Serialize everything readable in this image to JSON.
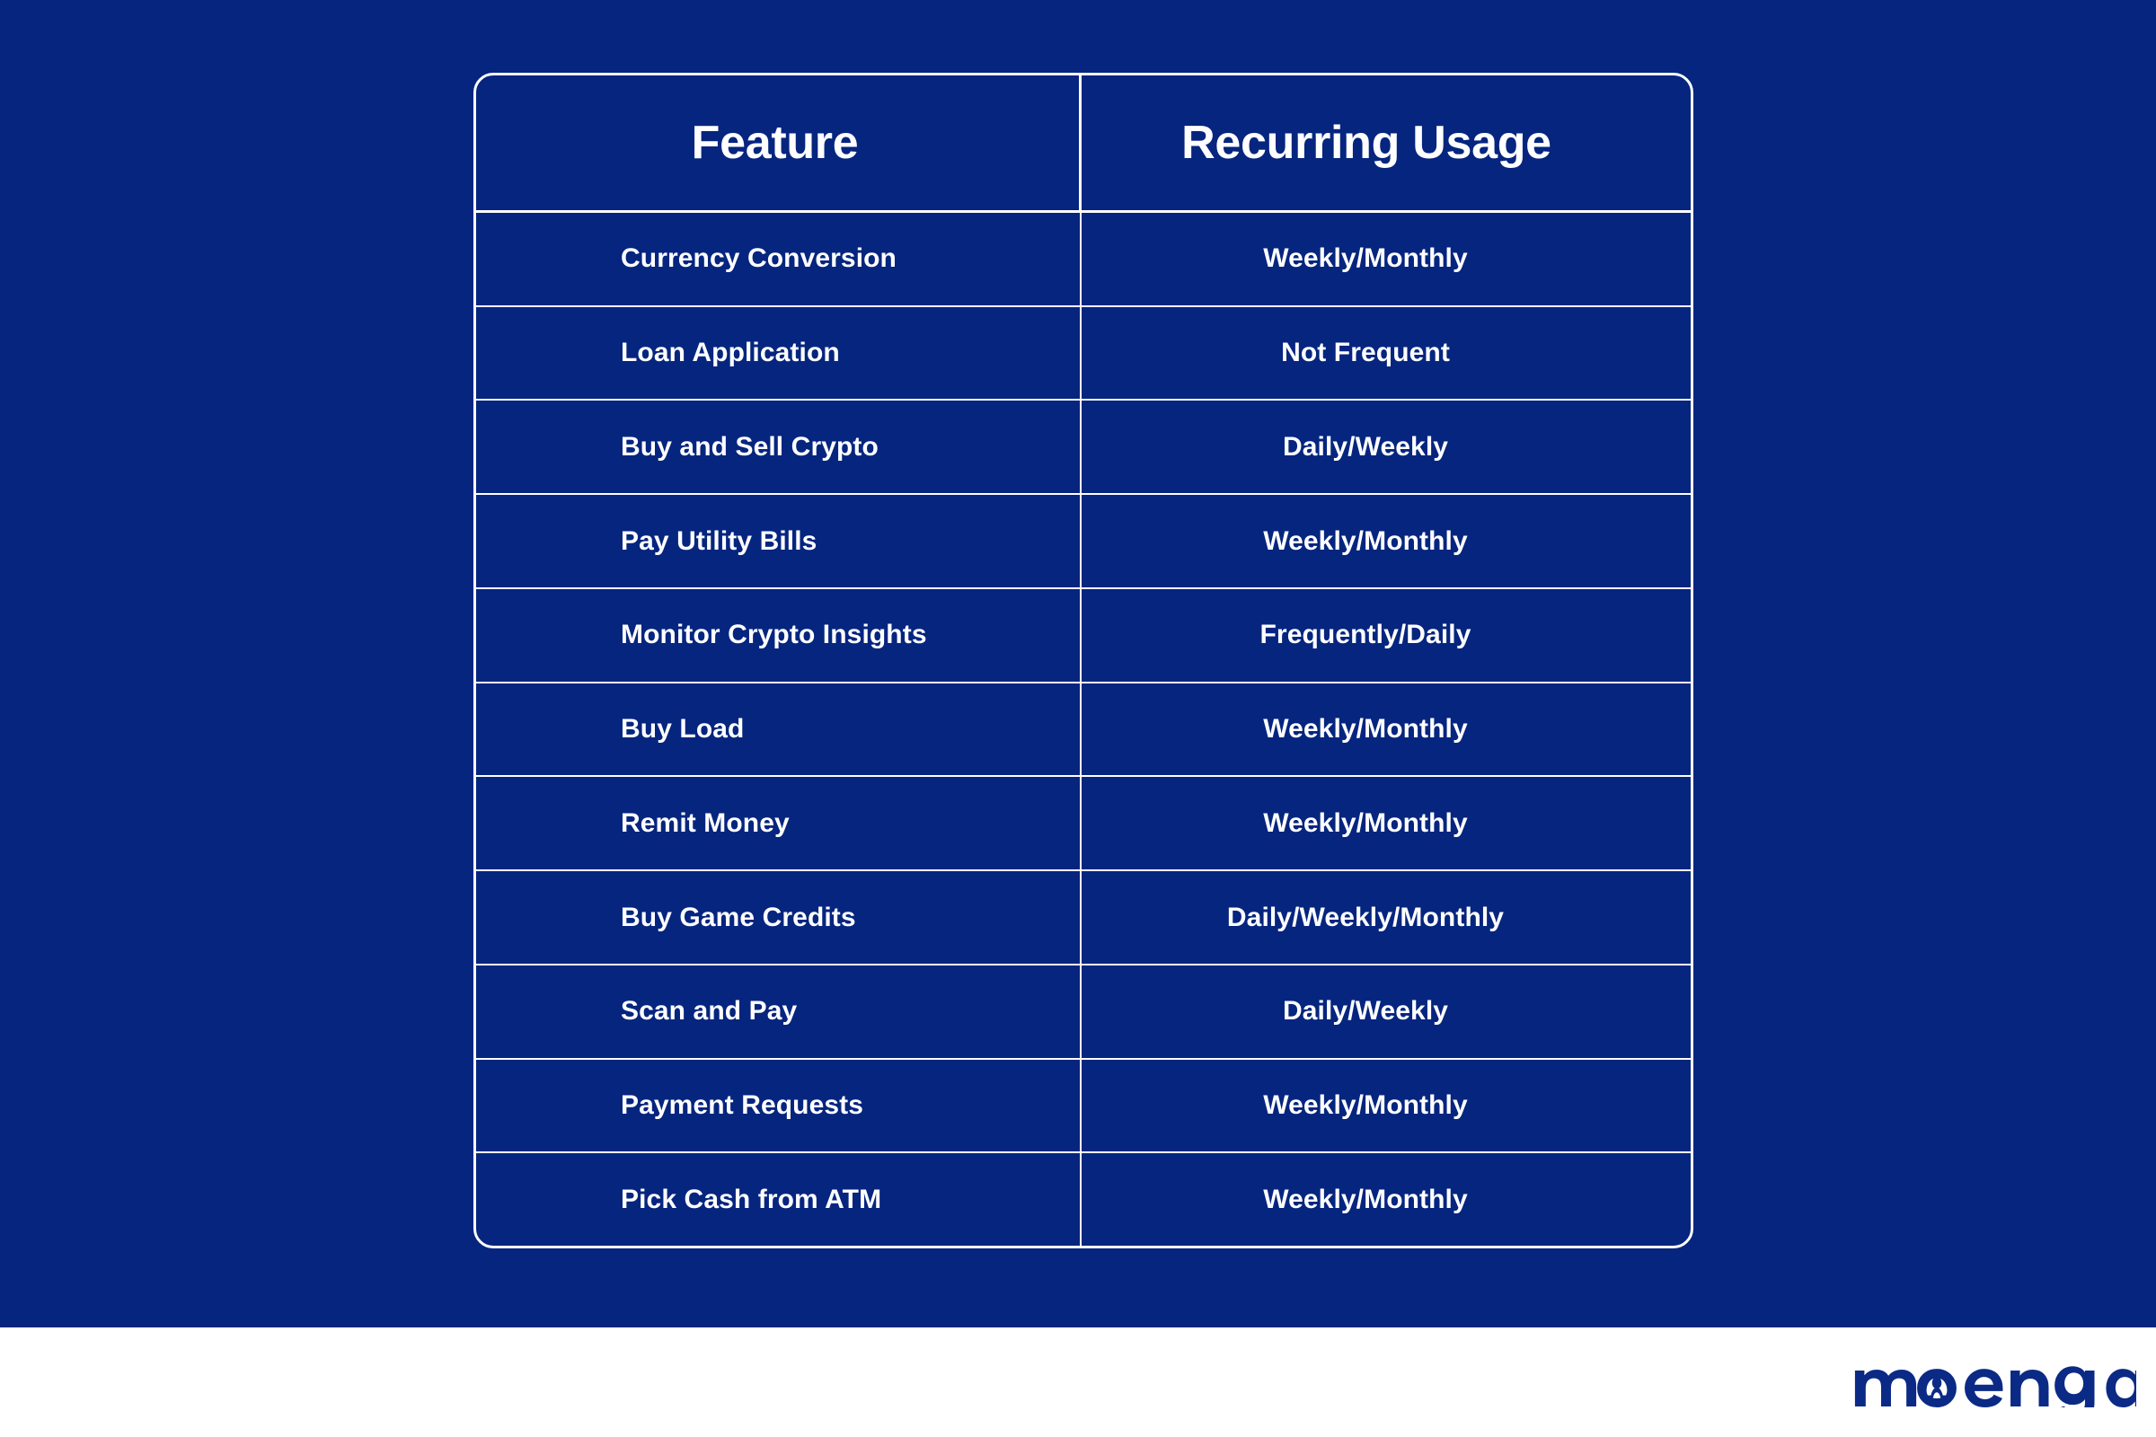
{
  "colors": {
    "background_blue": "#05257f",
    "footer_white": "#ffffff",
    "text_white": "#ffffff",
    "border_white": "#ffffff",
    "logo_blue": "#0b2a86"
  },
  "table": {
    "columns": [
      {
        "key": "feature",
        "label": "Feature"
      },
      {
        "key": "usage",
        "label": "Recurring Usage"
      }
    ],
    "rows": [
      {
        "feature": "Currency Conversion",
        "usage": "Weekly/Monthly"
      },
      {
        "feature": "Loan Application",
        "usage": "Not Frequent"
      },
      {
        "feature": "Buy and Sell Crypto",
        "usage": "Daily/Weekly"
      },
      {
        "feature": "Pay Utility Bills",
        "usage": "Weekly/Monthly"
      },
      {
        "feature": "Monitor Crypto Insights",
        "usage": "Frequently/Daily"
      },
      {
        "feature": "Buy Load",
        "usage": "Weekly/Monthly"
      },
      {
        "feature": "Remit Money",
        "usage": "Weekly/Monthly"
      },
      {
        "feature": "Buy Game Credits",
        "usage": "Daily/Weekly/Monthly"
      },
      {
        "feature": "Scan and Pay",
        "usage": "Daily/Weekly"
      },
      {
        "feature": "Payment Requests",
        "usage": "Weekly/Monthly"
      },
      {
        "feature": "Pick Cash from ATM",
        "usage": "Weekly/Monthly"
      }
    ]
  },
  "footer": {
    "logo_text": "moengage",
    "logo_icon": "moengage-logo"
  },
  "chart_data": {
    "type": "table",
    "title": "",
    "columns": [
      "Feature",
      "Recurring Usage"
    ],
    "rows": [
      [
        "Currency Conversion",
        "Weekly/Monthly"
      ],
      [
        "Loan Application",
        "Not Frequent"
      ],
      [
        "Buy and Sell Crypto",
        "Daily/Weekly"
      ],
      [
        "Pay Utility Bills",
        "Weekly/Monthly"
      ],
      [
        "Monitor Crypto Insights",
        "Frequently/Daily"
      ],
      [
        "Buy Load",
        "Weekly/Monthly"
      ],
      [
        "Remit Money",
        "Weekly/Monthly"
      ],
      [
        "Buy Game Credits",
        "Daily/Weekly/Monthly"
      ],
      [
        "Scan and Pay",
        "Daily/Weekly"
      ],
      [
        "Payment Requests",
        "Weekly/Monthly"
      ],
      [
        "Pick Cash from ATM",
        "Weekly/Monthly"
      ]
    ]
  }
}
